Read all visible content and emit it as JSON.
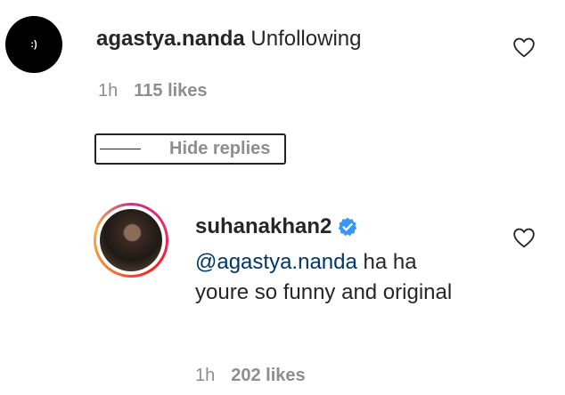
{
  "comment": {
    "avatar_text": ":)",
    "username": "agastya.nanda",
    "text": "Unfollowing",
    "time": "1h",
    "likes": "115 likes"
  },
  "hide_replies": {
    "label": "Hide replies"
  },
  "reply": {
    "username": "suhanakhan2",
    "verified": true,
    "mention": "@agastya.nanda",
    "text": " ha ha youre so funny and original",
    "time": "1h",
    "likes": "202 likes"
  },
  "colors": {
    "verified_badge": "#3897f0",
    "mention": "#00376b",
    "meta_gray": "#8e8e8e"
  },
  "icons": {
    "like": "heart-outline-icon",
    "verified": "verified-badge-icon"
  }
}
